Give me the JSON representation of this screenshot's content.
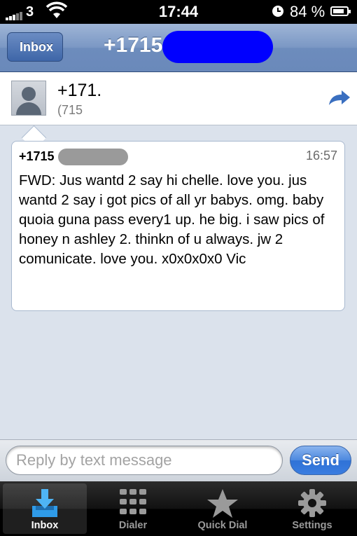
{
  "status_bar": {
    "carrier": "3",
    "time": "17:44",
    "battery": "84 %",
    "battery_level": 0.84
  },
  "nav": {
    "back_label": "Inbox",
    "title": "+1715"
  },
  "contact": {
    "name": "+171.",
    "subtitle": "(715"
  },
  "message": {
    "sender": "+1715",
    "time": "16:57",
    "body": "FWD: Jus wantd 2 say hi chelle. love you. jus wantd 2 say i got pics of all yr babys. omg. baby quoia guna pass every1 up. he big. i saw pics of honey n ashley 2. thinkn of u always. jw 2 comunicate. love you. x0x0x0x0 Vic"
  },
  "reply": {
    "placeholder": "Reply by text message",
    "send_label": "Send"
  },
  "tabs": [
    {
      "label": "Inbox",
      "icon": "inbox-download-icon",
      "active": true
    },
    {
      "label": "Dialer",
      "icon": "keypad-icon",
      "active": false
    },
    {
      "label": "Quick Dial",
      "icon": "star-icon",
      "active": false
    },
    {
      "label": "Settings",
      "icon": "gear-icon",
      "active": false
    }
  ],
  "colors": {
    "nav_blue": "#7a97c4",
    "send_blue": "#3a7de0",
    "redaction_blue": "#0000ff"
  }
}
